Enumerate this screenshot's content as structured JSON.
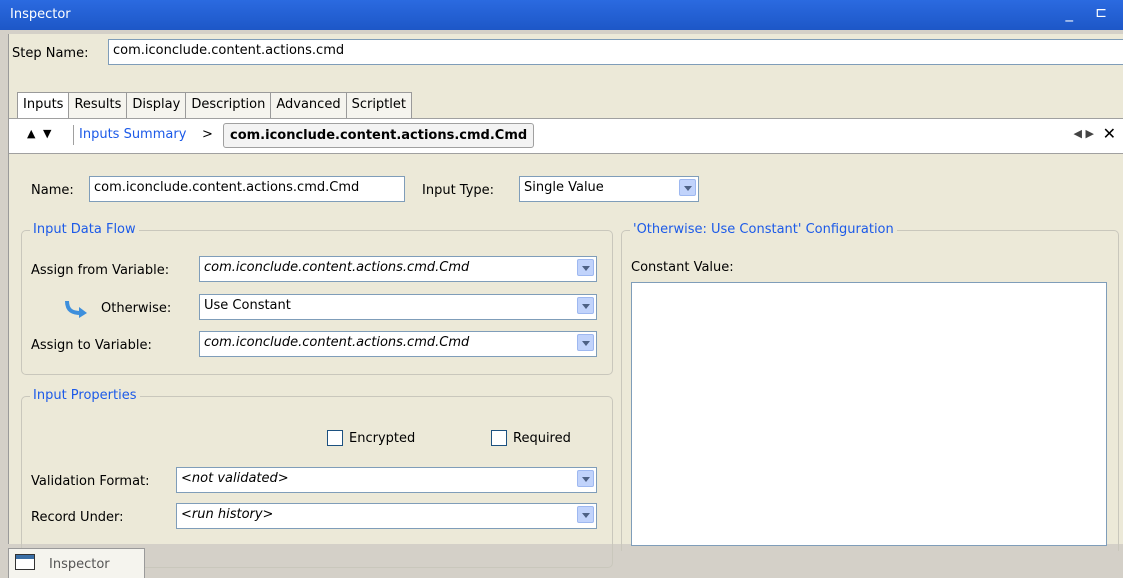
{
  "window": {
    "title": "Inspector",
    "minimize": "_",
    "restore": "⊏"
  },
  "step": {
    "label": "Step Name:",
    "value": "com.iconclude.content.actions.cmd"
  },
  "tabs": [
    {
      "label": "Inputs"
    },
    {
      "label": "Results"
    },
    {
      "label": "Display"
    },
    {
      "label": "Description"
    },
    {
      "label": "Advanced"
    },
    {
      "label": "Scriptlet"
    }
  ],
  "breadcrumb": {
    "up_arrow": "▲",
    "down_arrow": "▼",
    "link": "Inputs Summary",
    "separator": ">",
    "current": "com.iconclude.content.actions.cmd.Cmd",
    "prev": "◀",
    "next": "▶",
    "close": "✕"
  },
  "input": {
    "name_label": "Name:",
    "name_value": "com.iconclude.content.actions.cmd.Cmd",
    "type_label": "Input Type:",
    "type_value": "Single Value"
  },
  "data_flow": {
    "title": "Input Data Flow",
    "assign_from_label": "Assign from Variable:",
    "assign_from_value": "com.iconclude.content.actions.cmd.Cmd",
    "otherwise_label": "Otherwise:",
    "otherwise_value": "Use Constant",
    "assign_to_label": "Assign to Variable:",
    "assign_to_value": "com.iconclude.content.actions.cmd.Cmd"
  },
  "properties": {
    "title": "Input Properties",
    "encrypted_label": "Encrypted",
    "encrypted_checked": false,
    "required_label": "Required",
    "required_checked": false,
    "validation_label": "Validation Format:",
    "validation_value": "<not validated>",
    "record_label": "Record Under:",
    "record_value": "<run history>"
  },
  "constant_config": {
    "title": "'Otherwise: Use Constant' Configuration",
    "constant_label": "Constant Value:",
    "constant_value": ""
  },
  "bottom_tab": {
    "label": "Inspector",
    "icon": "window-icon"
  },
  "colors": {
    "title_bar": "#1d57c7",
    "panel": "#ece9d8",
    "link": "#1c5ae8"
  }
}
